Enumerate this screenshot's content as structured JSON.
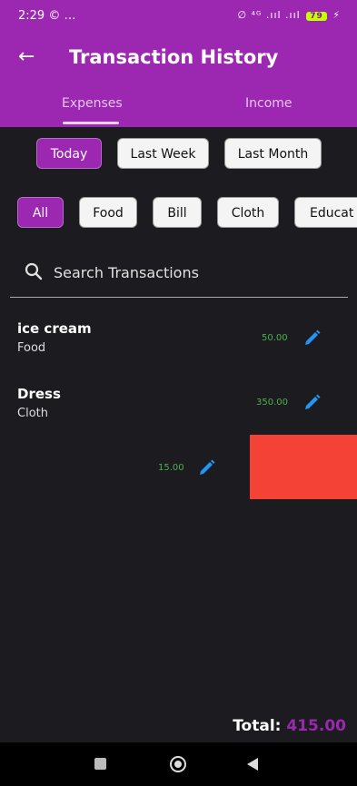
{
  "status_bar": {
    "time": "2:29",
    "left_icons": "© …",
    "right_text": "∅ ⁴ᴳ .ııl .ııl",
    "battery": "79"
  },
  "app_bar": {
    "back_icon": "←",
    "title": "Transaction History"
  },
  "tabs": [
    {
      "label": "Expenses",
      "selected": true
    },
    {
      "label": "Income",
      "selected": false
    }
  ],
  "period_filters": [
    {
      "label": "Today",
      "selected": true
    },
    {
      "label": "Last Week",
      "selected": false
    },
    {
      "label": "Last Month",
      "selected": false
    }
  ],
  "category_filters": [
    {
      "label": "All",
      "selected": true
    },
    {
      "label": "Food",
      "selected": false
    },
    {
      "label": "Bill",
      "selected": false
    },
    {
      "label": "Cloth",
      "selected": false
    },
    {
      "label": "Educat",
      "selected": false
    }
  ],
  "search": {
    "placeholder": "Search Transactions"
  },
  "transactions": [
    {
      "name": "ice cream",
      "category": "Food",
      "amount": "50.00"
    },
    {
      "name": "Dress",
      "category": "Cloth",
      "amount": "350.00"
    },
    {
      "name": "",
      "category": "",
      "amount": "15.00"
    }
  ],
  "total": {
    "label": "Total:",
    "value": "415.00"
  },
  "colors": {
    "primary": "#9c27b0",
    "background": "#1c1b1f",
    "amount": "#4caf50",
    "edit_icon": "#2196f3",
    "delete": "#f44336"
  }
}
